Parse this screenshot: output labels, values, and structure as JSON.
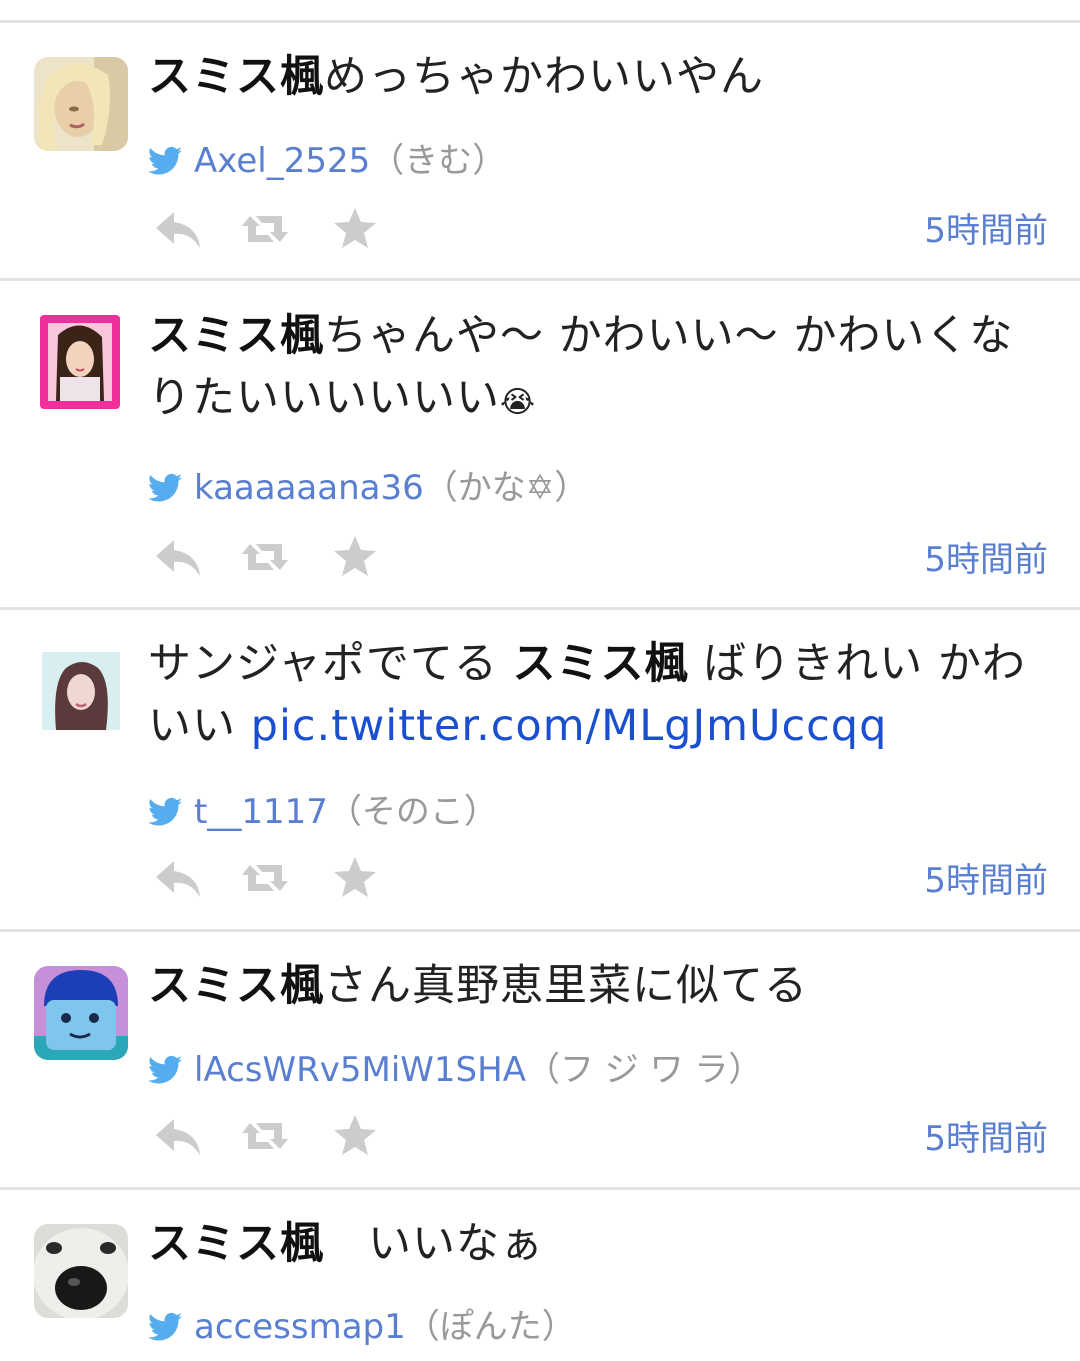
{
  "colors": {
    "accent": "#5a7fd0",
    "link": "#1a4fd0",
    "divider": "#e4e4e4",
    "icon": "#cccccc"
  },
  "tweets": [
    {
      "keyword": "スミス楓",
      "text_after": "めっちゃかわいいやん",
      "username": "Axel_2525",
      "nickname": "（きむ）",
      "time": "5時間前"
    },
    {
      "keyword": "スミス楓",
      "text_after": "ちゃんや〜 かわいい〜 かわいくなりたいいいいいい",
      "emoji": "😭",
      "username": "kaaaaaana36",
      "nickname": "（かな✡）",
      "time": "5時間前"
    },
    {
      "text_before": "サンジャポでてる ",
      "keyword": "スミス楓",
      "text_after": " ばりきれい かわいい ",
      "link": "pic.twitter.com/MLgJmUccqq",
      "username": "t__1117",
      "nickname": "（そのこ）",
      "time": "5時間前"
    },
    {
      "keyword": "スミス楓",
      "text_after": "さん真野恵里菜に似てる",
      "username": "lAcsWRv5MiW1SHA",
      "nickname": "（フ ジ ワ ラ）",
      "time": "5時間前"
    },
    {
      "keyword": "スミス楓",
      "text_after": "　いいなぁ",
      "username": "accessmap1",
      "nickname": "（ぽんた）"
    }
  ],
  "icons": {
    "bird": "twitter-bird-icon",
    "reply": "reply-icon",
    "retweet": "retweet-icon",
    "favorite": "star-icon"
  }
}
